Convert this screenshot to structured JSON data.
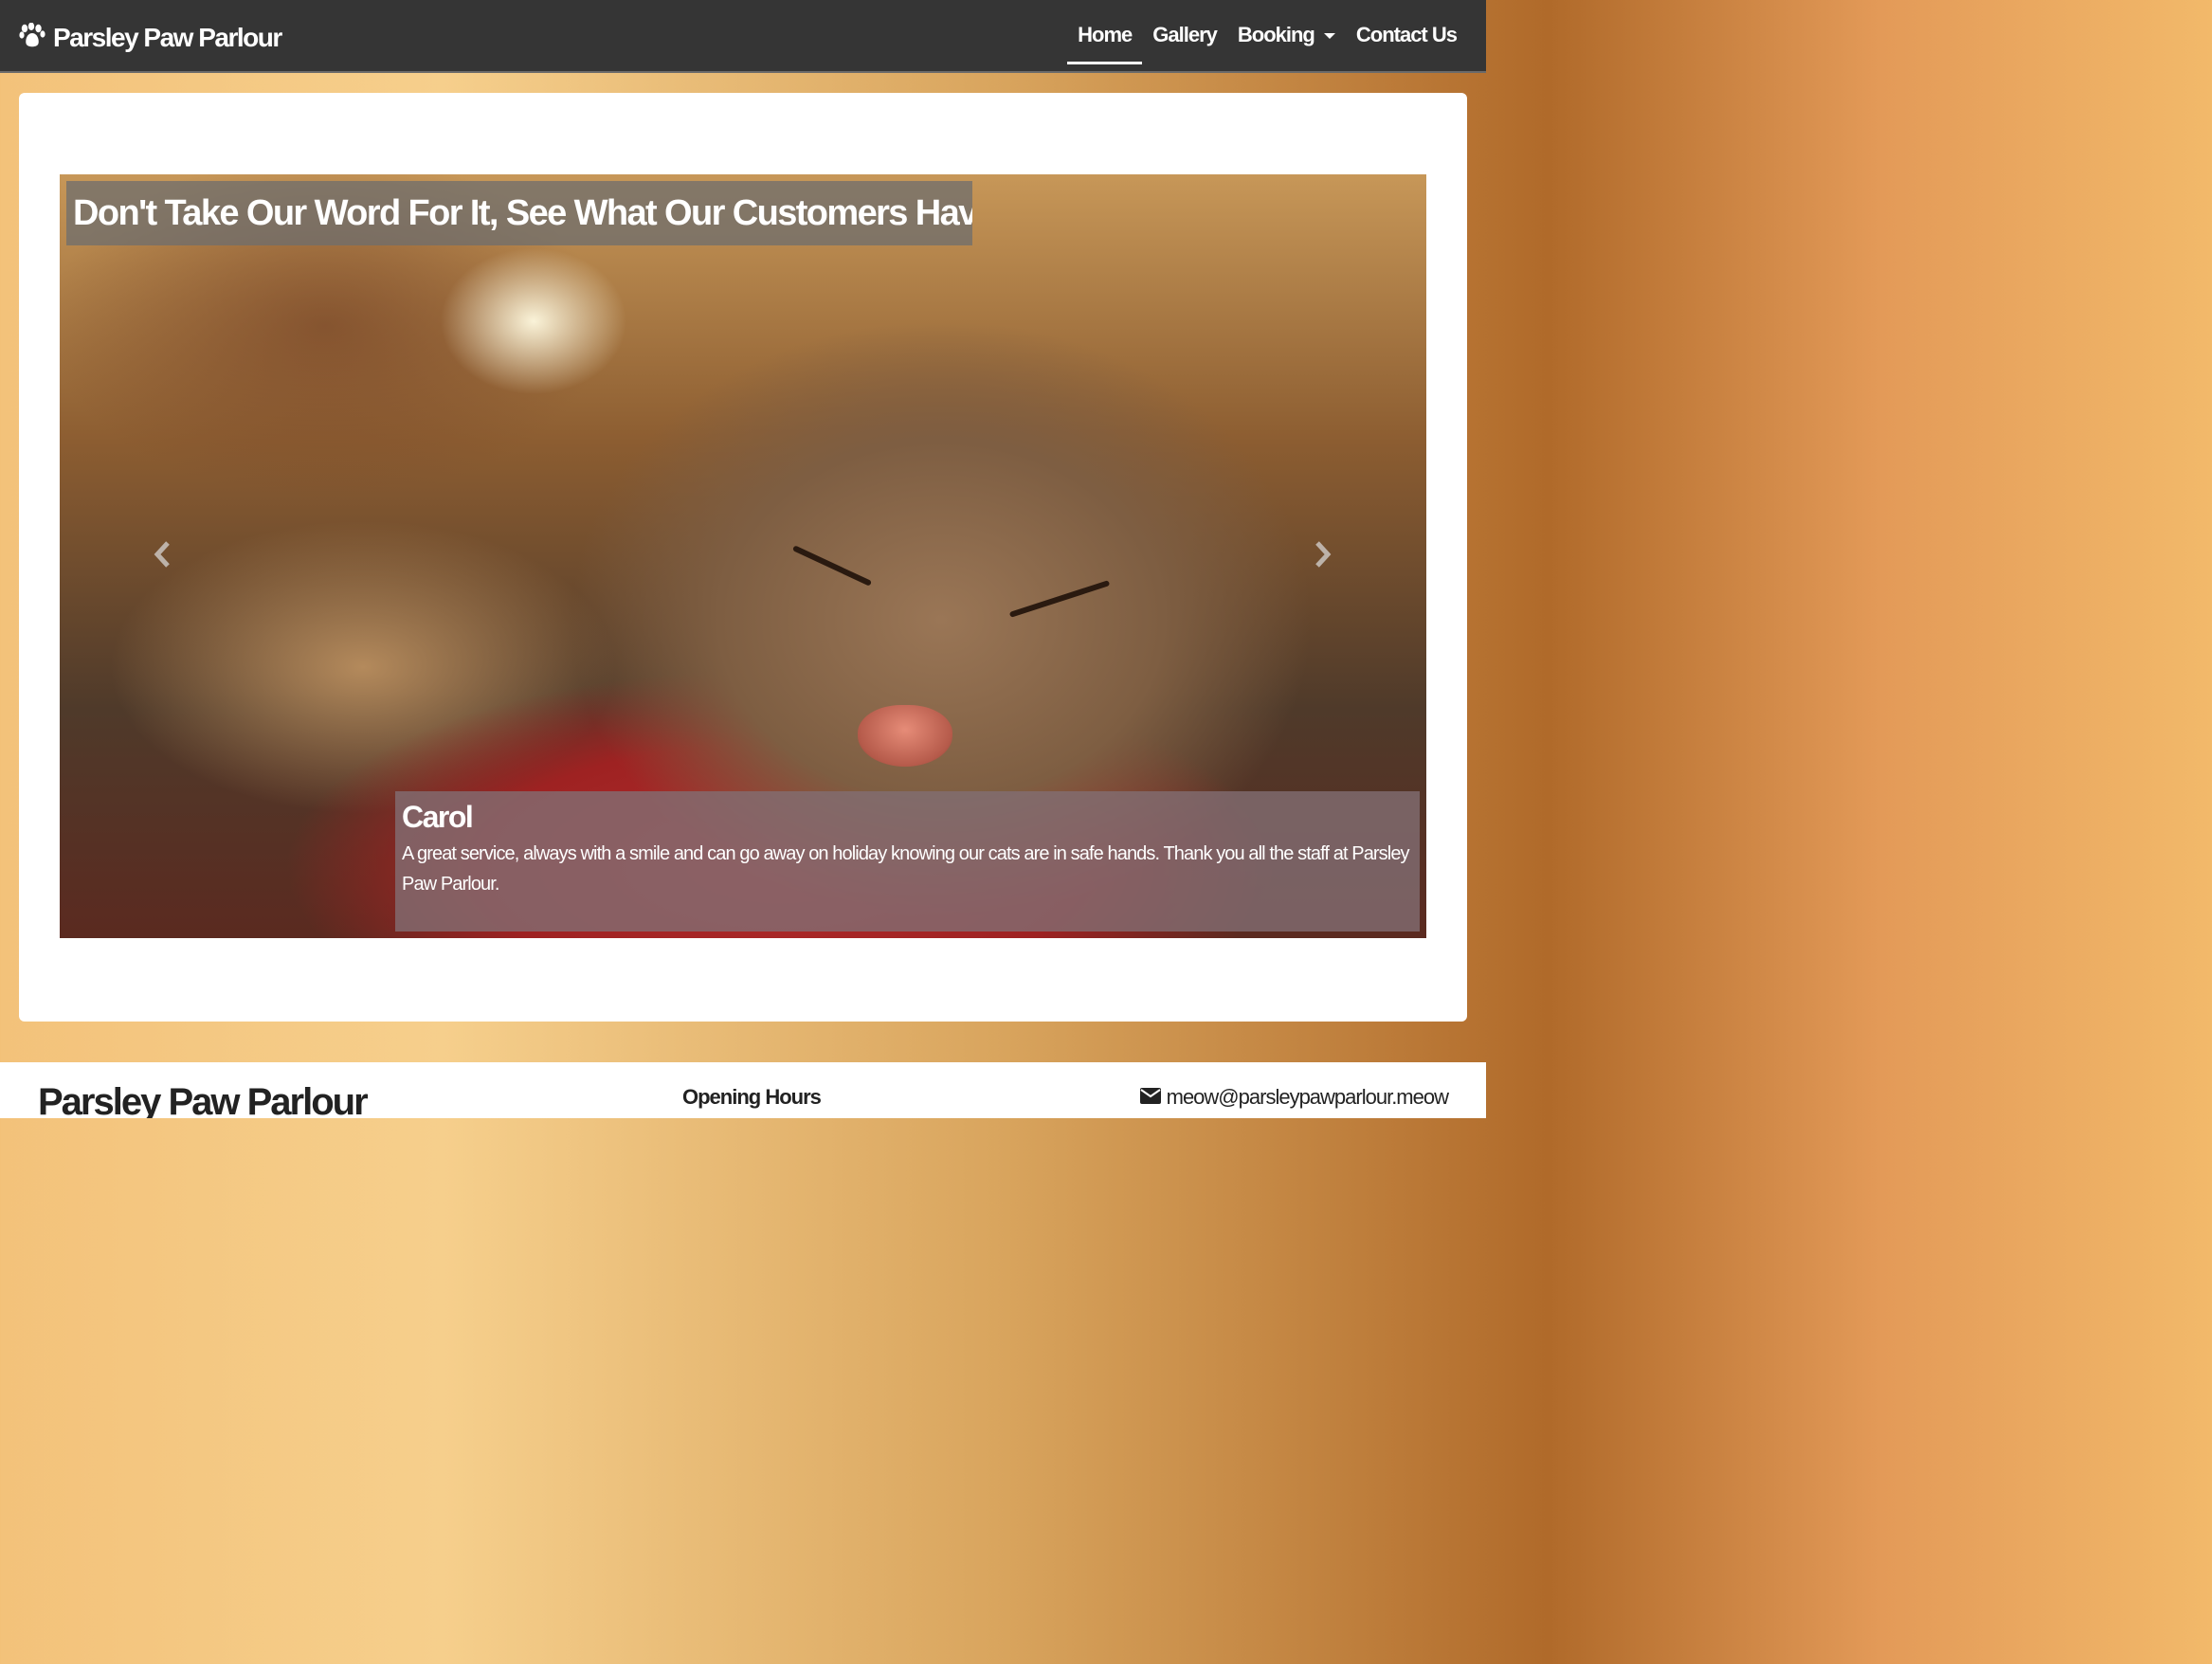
{
  "brand": {
    "name": "Parsley Paw Parlour",
    "icon": "paw-icon"
  },
  "nav": {
    "items": [
      {
        "label": "Home",
        "active": true
      },
      {
        "label": "Gallery",
        "active": false
      },
      {
        "label": "Booking",
        "active": false,
        "dropdown": true
      },
      {
        "label": "Contact Us",
        "active": false
      }
    ]
  },
  "carousel": {
    "heading": "Don't Take Our Word For It, See What Our Customers Have To Say!",
    "prev_icon": "chevron-left-icon",
    "next_icon": "chevron-right-icon",
    "slide": {
      "name": "Carol",
      "text": "A great service, always with a smile and can go away on holiday knowing our cats are in safe hands. Thank you all the staff at Parsley Paw Parlour."
    }
  },
  "footer": {
    "brand": "Parsley Paw Parlour",
    "hours_heading": "Opening Hours",
    "email": "meow@parsleypawparlour.meow",
    "email_icon": "envelope-icon"
  },
  "colors": {
    "navbar": "#353535",
    "caption_bg": "rgba(130,110,115,0.8)",
    "heading_bg": "rgba(110,110,110,0.75)"
  }
}
